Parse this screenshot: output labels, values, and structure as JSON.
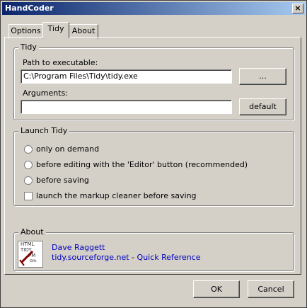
{
  "window": {
    "title": "HandCoder",
    "close_glyph": "×"
  },
  "tabs": [
    {
      "label": "Options"
    },
    {
      "label": "Tidy"
    },
    {
      "label": "About"
    }
  ],
  "tidy": {
    "legend": "Tidy",
    "path_label": "Path to executable:",
    "path_value": "C:\\Program Files\\Tidy\\tidy.exe",
    "browse_label": "...",
    "args_label": "Arguments:",
    "args_value": "",
    "default_label": "default"
  },
  "launch": {
    "legend": "Launch Tidy",
    "options": [
      {
        "label": "only on demand"
      },
      {
        "label": "before editing with the 'Editor' button (recommended)"
      },
      {
        "label": "before saving"
      }
    ],
    "cleaner_label": "launch the markup cleaner before saving"
  },
  "about": {
    "legend": "About",
    "author": "Dave Raggett",
    "site": "tidy.sourceforge.net",
    "separator": " - ",
    "quickref": "Quick Reference",
    "logo_lines": [
      "HTML",
      "TIDY",
      "PM",
      "Gifs"
    ]
  },
  "footer": {
    "ok_label": "OK",
    "cancel_label": "Cancel"
  }
}
